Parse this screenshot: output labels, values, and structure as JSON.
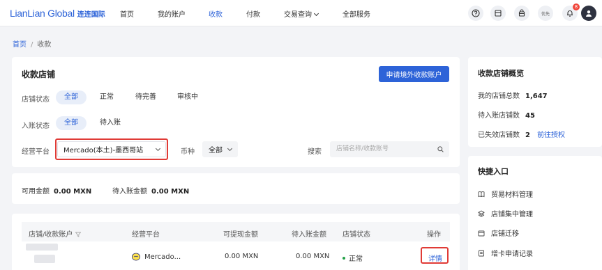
{
  "brand": {
    "name_en": "LianLian Global",
    "name_cn": "连连国际"
  },
  "nav": {
    "items": [
      {
        "label": "首页"
      },
      {
        "label": "我的账户"
      },
      {
        "label": "收款"
      },
      {
        "label": "付款"
      },
      {
        "label": "交易查询"
      },
      {
        "label": "全部服务"
      }
    ],
    "active_index": 2,
    "notification_count": "8",
    "vip_label": "优先"
  },
  "breadcrumb": {
    "home": "首页",
    "current": "收款"
  },
  "store_panel": {
    "title": "收款店铺",
    "apply_button": "申请境外收款账户",
    "store_status": {
      "label": "店铺状态",
      "options": [
        "全部",
        "正常",
        "待完善",
        "审核中"
      ],
      "selected": "全部"
    },
    "entry_status": {
      "label": "入账状态",
      "options": [
        "全部",
        "待入账"
      ],
      "selected": "全部"
    },
    "platform": {
      "label": "经营平台",
      "value": "Mercado(本土)-墨西哥站"
    },
    "currency": {
      "label": "币种",
      "value": "全部"
    },
    "search": {
      "label": "搜索",
      "placeholder": "店铺名称/收款账号"
    }
  },
  "amounts": {
    "available_label": "可用金额",
    "available_value": "0.00 MXN",
    "pending_label": "待入账金额",
    "pending_value": "0.00 MXN"
  },
  "table": {
    "headers": [
      "店铺/收款账户",
      "经营平台",
      "可提现金额",
      "待入账金额",
      "店铺状态",
      "操作"
    ],
    "rows": [
      {
        "platform": "Mercado...",
        "withdrawable": "0.00 MXN",
        "pending": "0.00 MXN",
        "status": "正常",
        "action": "详情"
      }
    ]
  },
  "overview": {
    "title": "收款店铺概览",
    "total_label": "我的店铺总数",
    "total_value": "1,647",
    "pending_label": "待入账店铺数",
    "pending_value": "45",
    "expired_label": "已失效店铺数",
    "expired_value": "2",
    "expired_link": "前往授权"
  },
  "quick_entry": {
    "title": "快捷入口",
    "items": [
      {
        "label": "贸易材料管理",
        "icon": "book-icon"
      },
      {
        "label": "店铺集中管理",
        "icon": "layers-icon"
      },
      {
        "label": "店铺迁移",
        "icon": "store-icon"
      },
      {
        "label": "增卡申请记录",
        "icon": "doc-icon"
      }
    ]
  },
  "colors": {
    "accent": "#2d63d8",
    "highlight": "#e03b36",
    "success": "#24a148"
  }
}
